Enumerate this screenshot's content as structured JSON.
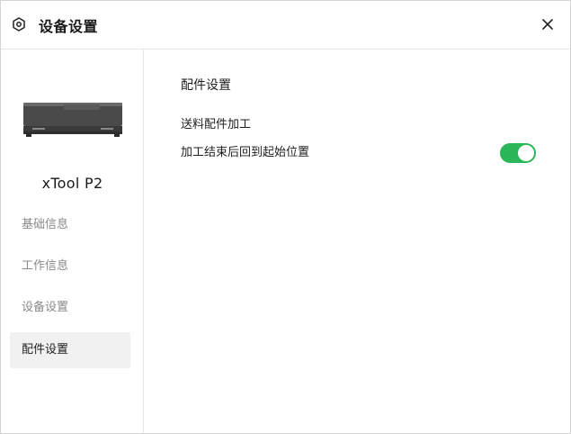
{
  "dialog": {
    "title": "设备设置",
    "icons": {
      "title": "hexagon-gear-icon",
      "close": "close-icon"
    }
  },
  "sidebar": {
    "device_name": "xTool P2",
    "device_image": "laser-cutter-device-image",
    "items": [
      {
        "label": "基础信息",
        "active": false
      },
      {
        "label": "工作信息",
        "active": false
      },
      {
        "label": "设备设置",
        "active": false
      },
      {
        "label": "配件设置",
        "active": true
      }
    ]
  },
  "main": {
    "section_title": "配件设置",
    "options": [
      {
        "label": "送料配件加工"
      },
      {
        "label": "加工结束后回到起始位置",
        "toggle_on": true
      }
    ]
  },
  "colors": {
    "toggle_on": "#2bb65a",
    "active_nav_bg": "#f1f1f1"
  }
}
